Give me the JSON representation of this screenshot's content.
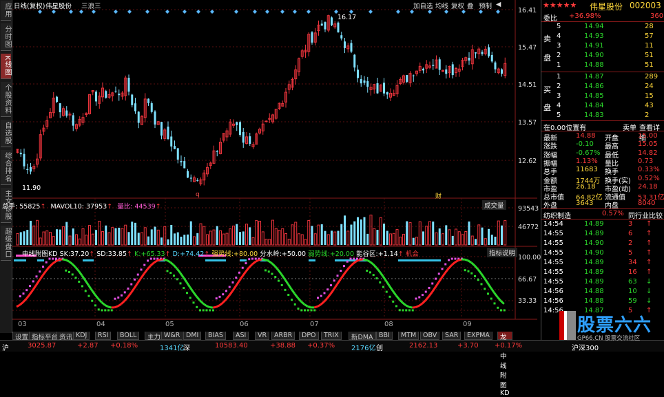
{
  "colors": {
    "up": "#e8333b",
    "down": "#7ee0ff",
    "kd_red": "#ff2020",
    "kd_green": "#2bd62b",
    "kd_magenta": "#e050e0",
    "grid": "#8a1a1a"
  },
  "left_tabs": [
    {
      "label": "应用",
      "active": false
    },
    {
      "label": "分时图",
      "active": false
    },
    {
      "label": "K线图",
      "active": true
    },
    {
      "label": "个股资料",
      "active": false
    },
    {
      "label": "自选股",
      "active": false
    },
    {
      "label": "综合排名",
      "active": false
    },
    {
      "label": "主文诊股",
      "active": false
    },
    {
      "label": "超级盘口",
      "active": false
    }
  ],
  "top_bar": {
    "title": "日线(复权)",
    "stock": "伟星股份",
    "pattern": "三浪三",
    "buttons": [
      "加自选",
      "均线",
      "复权",
      "叠",
      "预制",
      "◀"
    ]
  },
  "price_axis": [
    "16.41",
    "15.47",
    "14.51",
    "13.57",
    "12.62"
  ],
  "annotations": {
    "high": "16.17",
    "low": "11.90",
    "marker_q": "q",
    "marker_cai": "财"
  },
  "volume": {
    "label": "总手:",
    "total": "55825",
    "mavol_label": "MAVOL10:",
    "mavol": "37953",
    "ratio_label": "量比:",
    "ratio": "44539",
    "button": "成交量",
    "axis": [
      "93543",
      "46772"
    ]
  },
  "kd": {
    "name": "中线附图KD",
    "sk_label": "SK:",
    "sk": "37.20",
    "sd_label": "SD:",
    "sd": "33.85",
    "k_label": "K:",
    "k": "+65.33",
    "d_label": "D:",
    "d": "+74.42",
    "strong_label": "强势线:",
    "strong": "+80.00",
    "water_label": "分水岭:",
    "water": "+50.00",
    "weak_label": "弱势线:",
    "weak": "+20.00",
    "energy_label": "能谷区:",
    "energy": "+1.14",
    "chance": "机会",
    "button": "指标说明",
    "axis": [
      "100.00",
      "66.67",
      "33.33"
    ]
  },
  "x_axis": [
    "03",
    "04",
    "05",
    "06",
    "07",
    "08",
    "09"
  ],
  "bottom_tabs": [
    "设置",
    "指标平台",
    "资讯",
    "KDJ",
    "RSI",
    "BOLL",
    "主力",
    "W&R",
    "DMI",
    "BIAS",
    "ASI",
    "VR",
    "ARBR",
    "DPO",
    "TRIX",
    "新DMA",
    "BBI",
    "MTM",
    "OBV",
    "SAR",
    "EXPMA",
    "龙雀中线附图KD"
  ],
  "right_panel": {
    "stars": "★★★★★",
    "name": "伟星股份",
    "code": "002003",
    "webi_label": "委比",
    "webi": "+36.98%",
    "webi_cnt": "360",
    "sell_label": "卖",
    "sell_label2": "盘",
    "buy_label": "买",
    "buy_label2": "盘",
    "sell_orders": [
      {
        "n": "5",
        "p": "14.94",
        "v": "28"
      },
      {
        "n": "4",
        "p": "14.93",
        "v": "57"
      },
      {
        "n": "3",
        "p": "14.91",
        "v": "11"
      },
      {
        "n": "2",
        "p": "14.90",
        "v": "51"
      },
      {
        "n": "1",
        "p": "14.88",
        "v": "51"
      }
    ],
    "buy_orders": [
      {
        "n": "1",
        "p": "14.87",
        "v": "289"
      },
      {
        "n": "2",
        "p": "14.86",
        "v": "24"
      },
      {
        "n": "3",
        "p": "14.85",
        "v": "15"
      },
      {
        "n": "4",
        "p": "14.84",
        "v": "43"
      },
      {
        "n": "5",
        "p": "14.83",
        "v": "2"
      }
    ],
    "position": "在0.00位置有",
    "sell_detail": "卖单",
    "view_detail": "查看详细",
    "stats": [
      {
        "l1": "最新",
        "v1": "14.88",
        "l2": "开盘",
        "v2": "15.00"
      },
      {
        "l1": "涨跌",
        "v1": "-0.10",
        "l2": "最高",
        "v2": "15.05"
      },
      {
        "l1": "涨幅",
        "v1": "-0.67%",
        "l2": "最低",
        "v2": "14.82"
      },
      {
        "l1": "振幅",
        "v1": "1.13%",
        "l2": "量比",
        "v2": "0.73"
      },
      {
        "l1": "总手",
        "v1": "11683",
        "l2": "换手",
        "v2": "0.33%"
      },
      {
        "l1": "金额",
        "v1": "1744万",
        "l2": "换手(实)",
        "v2": "0.52%"
      },
      {
        "l1": "市盈",
        "v1": "26.18",
        "l2": "市盈(动)",
        "v2": "24.18"
      },
      {
        "l1": "总市值",
        "v1": "64.82亿",
        "l2": "流通值",
        "v2": "53.31亿"
      },
      {
        "l1": "外盘",
        "v1": "3643",
        "l2": "内盘",
        "v2": "8040"
      }
    ],
    "sector": "纺织制造",
    "sector_chg": "0.57%",
    "peer": "同行业比较",
    "ticks": [
      {
        "t": "14:54",
        "p": "14.89",
        "v": "3",
        "c": "red"
      },
      {
        "t": "14:55",
        "p": "14.89",
        "v": "6",
        "c": "red"
      },
      {
        "t": "14:55",
        "p": "14.90",
        "v": "2",
        "c": "red"
      },
      {
        "t": "14:55",
        "p": "14.90",
        "v": "5",
        "c": "red"
      },
      {
        "t": "14:55",
        "p": "14.89",
        "v": "34",
        "c": "red"
      },
      {
        "t": "14:55",
        "p": "14.89",
        "v": "16",
        "c": "red"
      },
      {
        "t": "14:55",
        "p": "14.89",
        "v": "63",
        "c": "green"
      },
      {
        "t": "14:56",
        "p": "14.88",
        "v": "10",
        "c": "green"
      },
      {
        "t": "14:56",
        "p": "14.88",
        "v": "59",
        "c": "green"
      },
      {
        "t": "14:56",
        "p": "14.87",
        "v": "5",
        "c": "red"
      }
    ]
  },
  "status_bar": {
    "sh_label": "沪",
    "sh_index": "3025.87",
    "sh_chg": "+2.87",
    "sh_pct": "+0.18%",
    "sh_amt": "1341亿",
    "sz_label": "深",
    "sz_index": "10583.40",
    "sz_chg": "+38.88",
    "sz_pct": "+0.37%",
    "sz_amt": "2176亿",
    "cy_label": "创",
    "cy_index": "2162.13",
    "cy_chg": "+3.70",
    "cy_pct": "+0.17%",
    "hs300": "沪深300"
  },
  "watermark": {
    "brand": "股票六六",
    "site": "GP66.CN 股票交流社区"
  }
}
